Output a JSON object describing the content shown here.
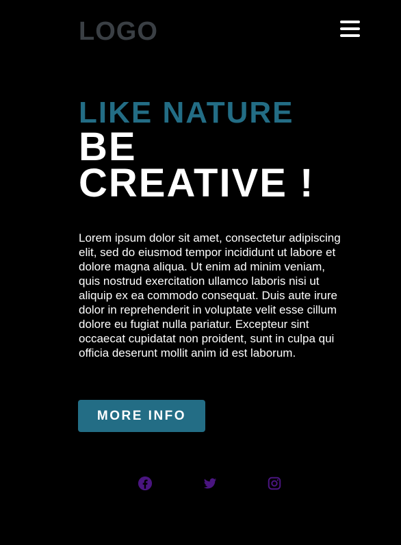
{
  "header": {
    "logo_text": "LOGO",
    "menu_icon": "hamburger-menu-icon"
  },
  "hero": {
    "kicker": "LIKE NATURE",
    "headline_line1": "BE",
    "headline_line2": "CREATIVE !",
    "body": "Lorem ipsum dolor sit amet, consectetur adipiscing elit, sed do eiusmod tempor incididunt ut labore et dolore magna aliqua. Ut enim ad minim veniam, quis nostrud exercitation ullamco laboris nisi ut aliquip ex ea commodo consequat. Duis aute irure dolor in reprehenderit in voluptate velit esse cillum dolore eu fugiat nulla pariatur. Excepteur sint occaecat cupidatat non proident, sunt in culpa qui officia deserunt mollit anim id est laborum.",
    "cta_label": "MORE INFO"
  },
  "social": [
    {
      "icon": "facebook-icon"
    },
    {
      "icon": "twitter-icon"
    },
    {
      "icon": "instagram-icon"
    }
  ],
  "colors": {
    "background": "#000000",
    "accent": "#236d85",
    "logo": "#3a3f44",
    "text": "#ffffff",
    "social_icons": "#4a1580"
  }
}
